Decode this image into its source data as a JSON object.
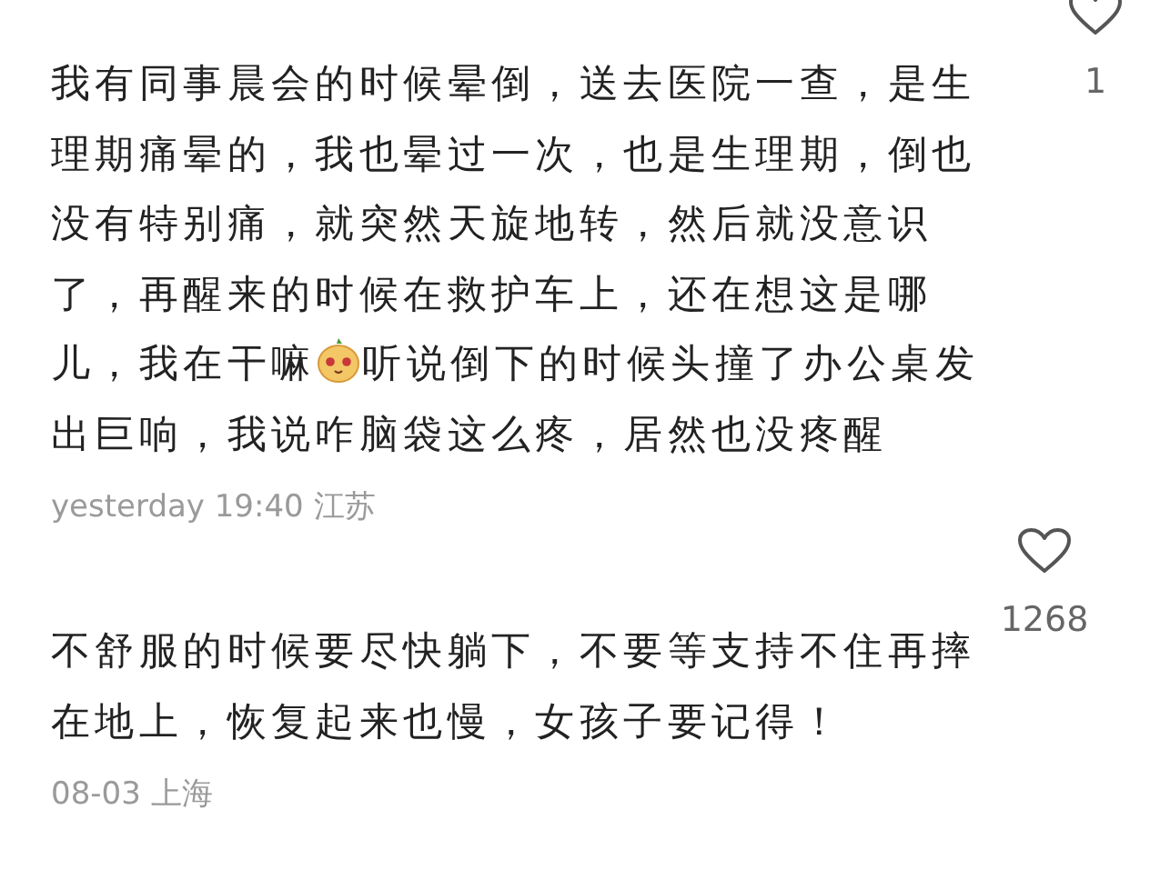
{
  "comments": [
    {
      "lines": [
        [
          {
            "kind": "text",
            "text": "我有同事晨会的时候晕倒，送去医院一查，是生"
          }
        ],
        [
          {
            "kind": "text",
            "text": "理期痛晕的，我也晕过一次，也是生理期，倒也"
          }
        ],
        [
          {
            "kind": "text",
            "text": "没有特别痛，就突然天旋地转，然后就没意识"
          }
        ],
        [
          {
            "kind": "text",
            "text": "了，再醒来的时候在救护车上，还在想这是哪"
          }
        ],
        [
          {
            "kind": "text",
            "text": "儿，我在干嘛"
          },
          {
            "kind": "emoji"
          },
          {
            "kind": "text",
            "text": "听说倒下的时候头撞了办公桌发"
          }
        ],
        [
          {
            "kind": "text",
            "text": "出巨响，我说咋脑袋这么疼，居然也没疼醒"
          }
        ]
      ],
      "meta": "yesterday 19:40 江苏",
      "likes": "1"
    },
    {
      "lines": [
        [
          {
            "kind": "text",
            "text": "不舒服的时候要尽快躺下，不要等支持不住再摔"
          }
        ],
        [
          {
            "kind": "text",
            "text": "在地上，恢复起来也慢，女孩子要记得！"
          }
        ]
      ],
      "meta": "08-03 上海",
      "likes": "1268"
    }
  ]
}
